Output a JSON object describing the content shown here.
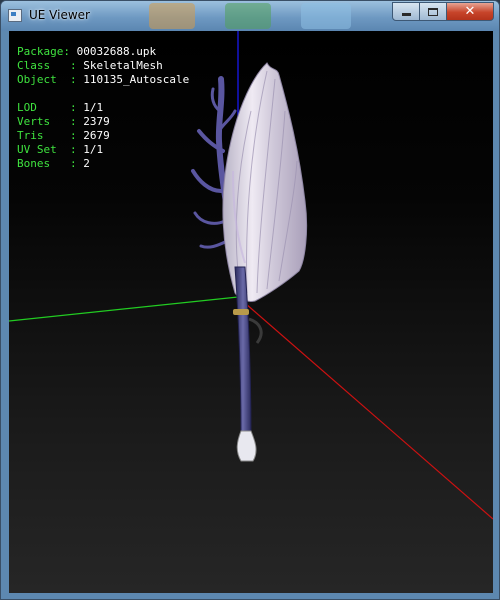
{
  "window": {
    "title": "UE Viewer",
    "controls": {
      "minimize": "minimize-icon",
      "maximize": "maximize-icon",
      "close": "close-icon"
    }
  },
  "info": {
    "package": {
      "label": "Package: ",
      "value": "00032688.upk"
    },
    "class": {
      "label": "Class   : ",
      "value": "SkeletalMesh"
    },
    "object": {
      "label": "Object  : ",
      "value": "110135_Autoscale"
    },
    "lod": {
      "label": "LOD     : ",
      "value": "1/1"
    },
    "verts": {
      "label": "Verts   : ",
      "value": "2379"
    },
    "tris": {
      "label": "Tris    : ",
      "value": "2679"
    },
    "uvset": {
      "label": "UV Set  : ",
      "value": "1/1"
    },
    "bones": {
      "label": "Bones   : ",
      "value": "2"
    }
  },
  "colors": {
    "label_green": "#3fe33f",
    "axis_x": "#cc1111",
    "axis_y": "#22cc22",
    "axis_z": "#1a1aff",
    "staff": "#4a4a8c",
    "fan": "#d9d4e2"
  }
}
